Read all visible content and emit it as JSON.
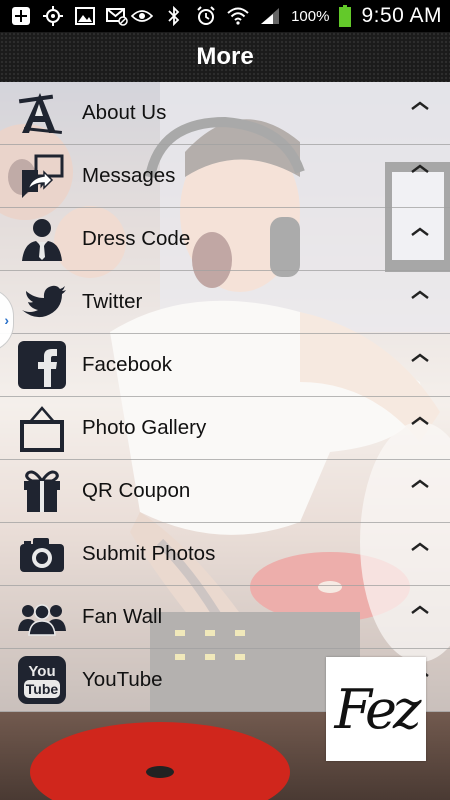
{
  "status_bar": {
    "battery_percent": "100%",
    "time": "9:50 AM",
    "left_icons": [
      "add-icon",
      "gps-icon",
      "image-icon",
      "mail-off-icon"
    ],
    "right_icons": [
      "eye-icon",
      "bluetooth-icon",
      "alarm-icon",
      "wifi-icon",
      "signal-icon",
      "battery-icon"
    ]
  },
  "header": {
    "title": "More"
  },
  "menu": {
    "items": [
      {
        "label": "About Us",
        "icon": "letter-a-icon"
      },
      {
        "label": "Messages",
        "icon": "message-icon"
      },
      {
        "label": "Dress Code",
        "icon": "person-tie-icon"
      },
      {
        "label": "Twitter",
        "icon": "twitter-bird-icon"
      },
      {
        "label": "Facebook",
        "icon": "facebook-icon"
      },
      {
        "label": "Photo Gallery",
        "icon": "picture-frame-icon"
      },
      {
        "label": "QR Coupon",
        "icon": "gift-icon"
      },
      {
        "label": "Submit Photos",
        "icon": "camera-icon"
      },
      {
        "label": "Fan Wall",
        "icon": "people-group-icon"
      },
      {
        "label": "YouTube",
        "icon": "youtube-icon"
      }
    ]
  },
  "side_tab": {
    "arrow": "›"
  },
  "logo": {
    "text": "Fez"
  },
  "colors": {
    "header_bg": "#1b1b1b",
    "menu_text": "#111111",
    "side_tab_arrow": "#2a70c9"
  }
}
